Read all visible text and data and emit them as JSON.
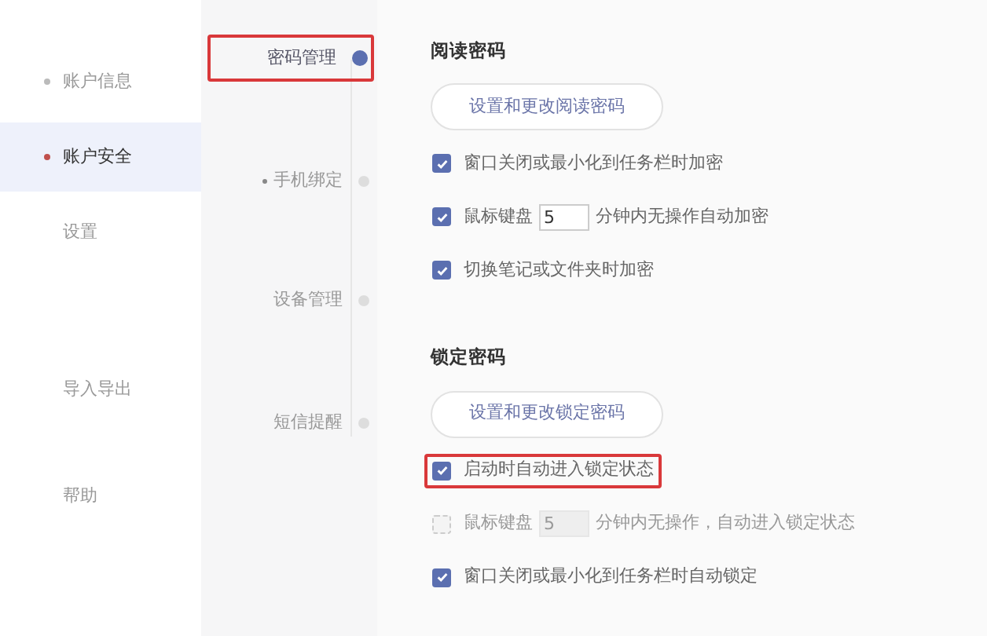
{
  "sidebar": {
    "items": [
      {
        "label": "账户信息",
        "selected": false,
        "dot": true
      },
      {
        "label": "账户安全",
        "selected": true,
        "dot": true
      },
      {
        "label": "设置",
        "selected": false,
        "dot": false
      },
      {
        "label": "导入导出",
        "selected": false,
        "dot": false
      },
      {
        "label": "帮助",
        "selected": false,
        "dot": false
      }
    ]
  },
  "subnav": {
    "items": [
      {
        "label": "密码管理",
        "selected": true,
        "dot": false,
        "highlighted": true
      },
      {
        "label": "手机绑定",
        "selected": false,
        "dot": true,
        "highlighted": false
      },
      {
        "label": "设备管理",
        "selected": false,
        "dot": false,
        "highlighted": false
      },
      {
        "label": "短信提醒",
        "selected": false,
        "dot": false,
        "highlighted": false
      }
    ]
  },
  "sections": [
    {
      "title": "阅读密码",
      "button": "设置和更改阅读密码",
      "options": [
        {
          "kind": "plain",
          "label": "窗口关闭或最小化到任务栏时加密",
          "checked": true,
          "disabled": false,
          "highlighted": false
        },
        {
          "kind": "minutes",
          "label": "鼠标键盘",
          "value": "5",
          "suffix": "分钟内无操作自动加密",
          "checked": true,
          "disabled": false,
          "highlighted": false
        },
        {
          "kind": "plain",
          "label": "切换笔记或文件夹时加密",
          "checked": true,
          "disabled": false,
          "highlighted": false
        }
      ]
    },
    {
      "title": "锁定密码",
      "button": "设置和更改锁定密码",
      "options": [
        {
          "kind": "plain",
          "label": "启动时自动进入锁定状态",
          "checked": true,
          "disabled": false,
          "highlighted": true
        },
        {
          "kind": "minutes",
          "label": "鼠标键盘",
          "value": "5",
          "suffix": "分钟内无操作，自动进入锁定状态",
          "checked": false,
          "disabled": true,
          "highlighted": false
        },
        {
          "kind": "plain",
          "label": "窗口关闭或最小化到任务栏时自动锁定",
          "checked": true,
          "disabled": false,
          "highlighted": false
        }
      ]
    }
  ]
}
